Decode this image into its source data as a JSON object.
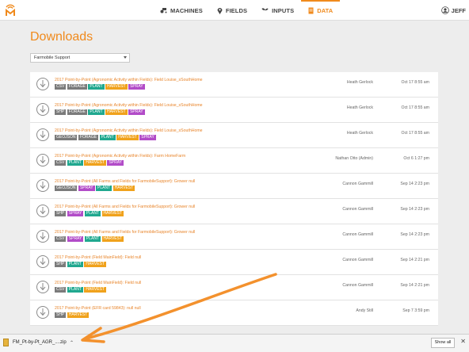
{
  "nav": {
    "items": [
      {
        "label": "MACHINES",
        "icon": "tractor-icon",
        "active": false
      },
      {
        "label": "FIELDS",
        "icon": "map-pin-icon",
        "active": false
      },
      {
        "label": "INPUTS",
        "icon": "sprout-icon",
        "active": false
      },
      {
        "label": "DATA",
        "icon": "document-icon",
        "active": true
      }
    ],
    "user": "JEFF"
  },
  "page": {
    "title": "Downloads",
    "org_select": "Farmobile Support"
  },
  "colors": {
    "accent": "#f08a1c",
    "CSV": "#7b7b7b",
    "SHP": "#7b7b7b",
    "GEOJSON": "#7b7b7b",
    "FORAGE": "#7b7b7b",
    "PLANT": "#20a88f",
    "HARVEST": "#f0a21c",
    "SPRAY": "#b24cc8"
  },
  "downloads": [
    {
      "title": "2017 Point-by-Point (Agronomic Activity within Fields): Field Louise_sSouthHome",
      "tags": [
        "CSV",
        "FORAGE",
        "PLANT",
        "HARVEST",
        "SPRAY"
      ],
      "user": "Heath Gerlock",
      "date": "Oct 17 8:55 am"
    },
    {
      "title": "2017 Point-by-Point (Agronomic Activity within Fields): Field Louise_sSouthHome",
      "tags": [
        "SHP",
        "FORAGE",
        "PLANT",
        "HARVEST",
        "SPRAY"
      ],
      "user": "Heath Gerlock",
      "date": "Oct 17 8:55 am"
    },
    {
      "title": "2017 Point-by-Point (Agronomic Activity within Fields): Field Louise_sSouthHome",
      "tags": [
        "GEOJSON",
        "FORAGE",
        "PLANT",
        "HARVEST",
        "SPRAY"
      ],
      "user": "Heath Gerlock",
      "date": "Oct 17 8:55 am"
    },
    {
      "title": "2017 Point-by-Point (Agronomic Activity within Fields): Farm HomeFarm",
      "tags": [
        "CSV",
        "PLANT",
        "HARVEST",
        "SPRAY"
      ],
      "user": "Nathan Otto (Admin)",
      "date": "Oct 6 1:27 pm"
    },
    {
      "title": "2017 Point-by-Point (All Farms and Fields for FarmobileSupport): Grower null",
      "tags": [
        "GEOJSON",
        "SPRAY",
        "PLANT",
        "HARVEST"
      ],
      "user": "Cannon Gammill",
      "date": "Sep 14 2:23 pm"
    },
    {
      "title": "2017 Point-by-Point (All Farms and Fields for FarmobileSupport): Grower null",
      "tags": [
        "SHP",
        "SPRAY",
        "PLANT",
        "HARVEST"
      ],
      "user": "Cannon Gammill",
      "date": "Sep 14 2:23 pm"
    },
    {
      "title": "2017 Point-by-Point (All Farms and Fields for FarmobileSupport): Grower null",
      "tags": [
        "CSV",
        "SPRAY",
        "PLANT",
        "HARVEST"
      ],
      "user": "Cannon Gammill",
      "date": "Sep 14 2:23 pm"
    },
    {
      "title": "2017 Point-by-Point (Field MainField): Field null",
      "tags": [
        "SHP",
        "PLANT",
        "HARVEST"
      ],
      "user": "Cannon Gammill",
      "date": "Sep 14 2:21 pm"
    },
    {
      "title": "2017 Point-by-Point (Field MainField): Field null",
      "tags": [
        "CSV",
        "PLANT",
        "HARVEST"
      ],
      "user": "Cannon Gammill",
      "date": "Sep 14 2:21 pm"
    },
    {
      "title": "2017 Point-by-Point (EFR card 59843): null null",
      "tags": [
        "SHP",
        "HARVEST"
      ],
      "user": "Andy Still",
      "date": "Sep 7 3:59 pm"
    }
  ],
  "download_bar": {
    "file_name": "FM_Pt-by-Pt_AGR_....zip",
    "show_all": "Show all"
  }
}
